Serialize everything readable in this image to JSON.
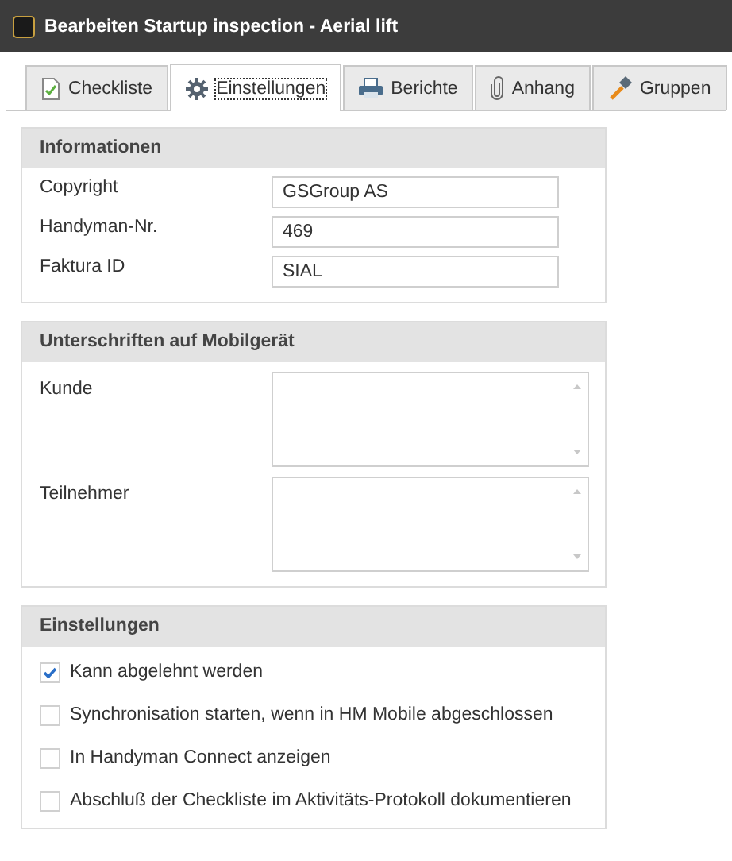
{
  "window": {
    "title": "Bearbeiten Startup inspection - Aerial lift"
  },
  "tabs": [
    {
      "label": "Checkliste",
      "kind": "checklist",
      "selected": false
    },
    {
      "label": "Einstellungen",
      "kind": "gear",
      "selected": true
    },
    {
      "label": "Berichte",
      "kind": "printer",
      "selected": false
    },
    {
      "label": "Anhang",
      "kind": "paperclip",
      "selected": false
    },
    {
      "label": "Gruppen",
      "kind": "hammer",
      "selected": false
    }
  ],
  "informationen": {
    "title": "Informationen",
    "fields": [
      {
        "label": "Copyright",
        "value": "GSGroup AS"
      },
      {
        "label": "Handyman-Nr.",
        "value": "469"
      },
      {
        "label": "Faktura ID",
        "value": "SIAL"
      }
    ]
  },
  "unterschriften": {
    "title": "Unterschriften auf Mobilgerät",
    "fields": [
      {
        "label": "Kunde"
      },
      {
        "label": "Teilnehmer"
      }
    ]
  },
  "einstellungen": {
    "title": "Einstellungen",
    "options": [
      {
        "label": "Kann abgelehnt werden",
        "checked": true
      },
      {
        "label": "Synchronisation starten, wenn in HM Mobile abgeschlossen",
        "checked": false
      },
      {
        "label": "In Handyman Connect anzeigen",
        "checked": false
      },
      {
        "label": "Abschluß der Checkliste im Aktivitäts-Protokoll dokumentieren",
        "checked": false
      }
    ]
  }
}
